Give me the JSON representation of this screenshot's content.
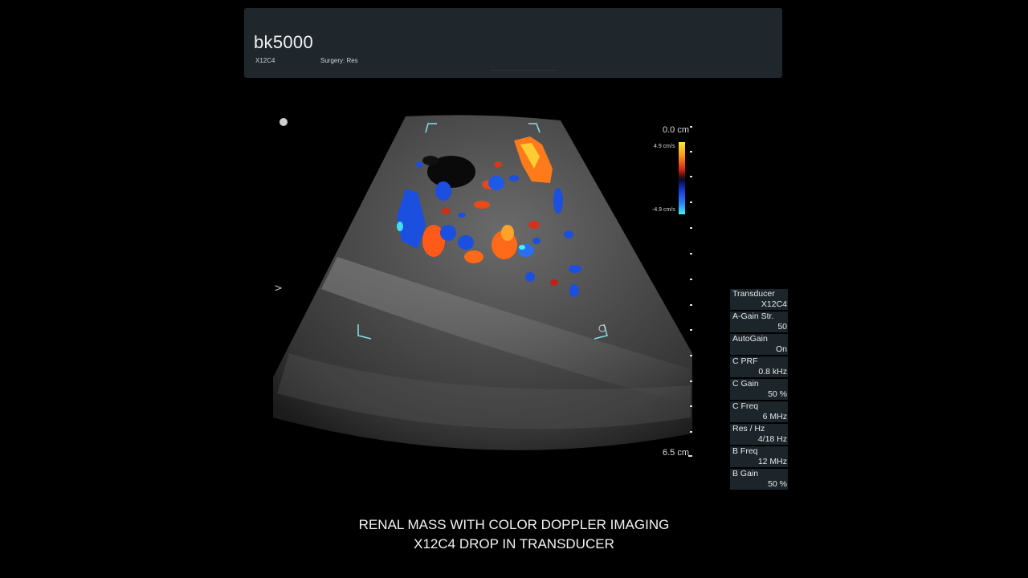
{
  "header": {
    "brand_prefix": "bk",
    "brand_number": "5000",
    "transducer": "X12C4",
    "preset": "Surgery: Res"
  },
  "image": {
    "depth_top": "0.0 cm",
    "depth_bottom": "6.5 cm",
    "velocity_max": "4.9 cm/s",
    "velocity_min": "-4.9 cm/s",
    "focus_marker": ">",
    "colors": {
      "doppler_positive": "#ff6a1a",
      "doppler_negative": "#1a4fe0",
      "roi_box": "#7fe3e8"
    }
  },
  "params": [
    {
      "label": "Transducer",
      "value": "X12C4"
    },
    {
      "label": "A-Gain Str.",
      "value": "50"
    },
    {
      "label": "AutoGain",
      "value": "On"
    },
    {
      "label": "C PRF",
      "value": "0.8 kHz"
    },
    {
      "label": "C Gain",
      "value": "50 %"
    },
    {
      "label": "C Freq",
      "value": "6 MHz"
    },
    {
      "label": "Res / Hz",
      "value": "4/18 Hz"
    },
    {
      "label": "B Freq",
      "value": "12 MHz"
    },
    {
      "label": "B Gain",
      "value": "50 %"
    }
  ],
  "caption": {
    "line1": "RENAL MASS WITH COLOR DOPPLER IMAGING",
    "line2": "X12C4 DROP IN TRANSDUCER"
  }
}
